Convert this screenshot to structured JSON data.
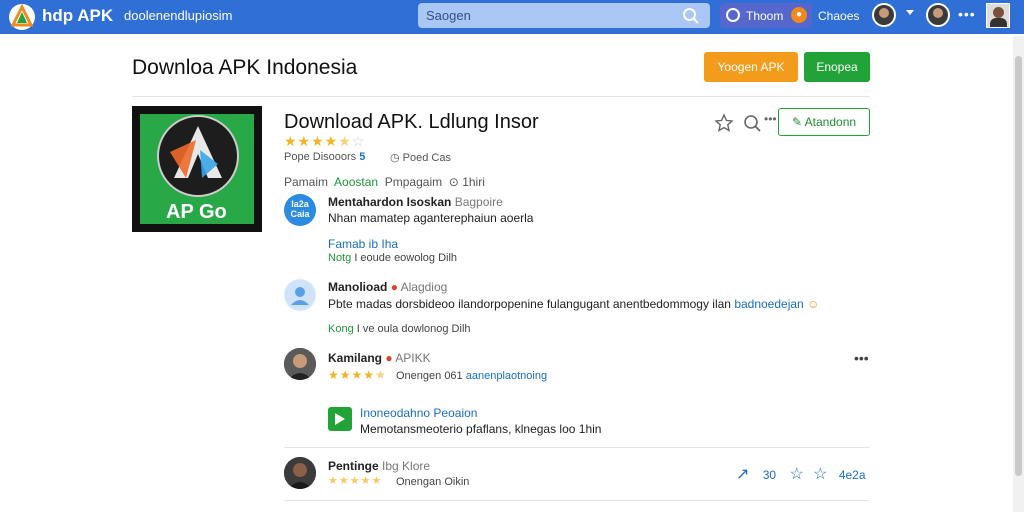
{
  "topbar": {
    "brand_name": "hdp APK",
    "brand_tagline": "doolenendlupiosim",
    "search_placeholder": "Saogen",
    "pill_label": "Thoom",
    "label": "Chaoes"
  },
  "header": {
    "title": "Downloa APK Indonesia",
    "orange_button": "Yoogen APK",
    "green_button": "Enopea"
  },
  "app": {
    "icon_text": "AP Go",
    "title": "Download APK. Ldlung Insor",
    "rating": 4.5,
    "meta_left": "Pope Disooors",
    "meta_badge": "5",
    "meta_right": "Poed Cas",
    "action_button": "Atandonn"
  },
  "tabs": {
    "label_1": "Pamaim",
    "label_active": "Aoostan",
    "label_2": "Pmpagaim",
    "counter": "1hiri"
  },
  "reviews": [
    {
      "name": "Mentahardon Isoskan",
      "sub": "Bagpoire",
      "avatar_text": "Ia2a\nCaia",
      "body": "Nhan mamatep aganterephaiun aoerla",
      "link": "Famab ib Iha",
      "foot_green": "Notg",
      "foot": "I eoude eowolog Dilh"
    },
    {
      "name": "Manolioad",
      "sub": "Alagdiog",
      "body": "Pbte madas dorsbideoo ilandorpopenine fulangugant anentbedommogy ilan",
      "body_link": "badnoedejan",
      "foot_green": "Kong",
      "foot": "I ve oula dowlonog Dilh"
    },
    {
      "name": "Kamilang",
      "sub": "APIKK",
      "rating": 4.5,
      "rating_text": "Onengen 061",
      "rating_link": "aanenplaotnoing",
      "reply_title": "Inoneodahno",
      "reply_link": "Peoaion",
      "reply_body": "Memotansmeoterio pfaflans, klnegas loo 1hin"
    },
    {
      "name": "Pentinge",
      "sub": "Ibg Klore",
      "rating_text": "Onengan Oikin",
      "share_count_1": "30",
      "share_count_2": "4e2a"
    }
  ],
  "colors": {
    "topbar": "#2f6fd6",
    "orange": "#f39c1b",
    "green": "#22a338",
    "link": "#1a6fc2",
    "star": "#f0b425"
  }
}
